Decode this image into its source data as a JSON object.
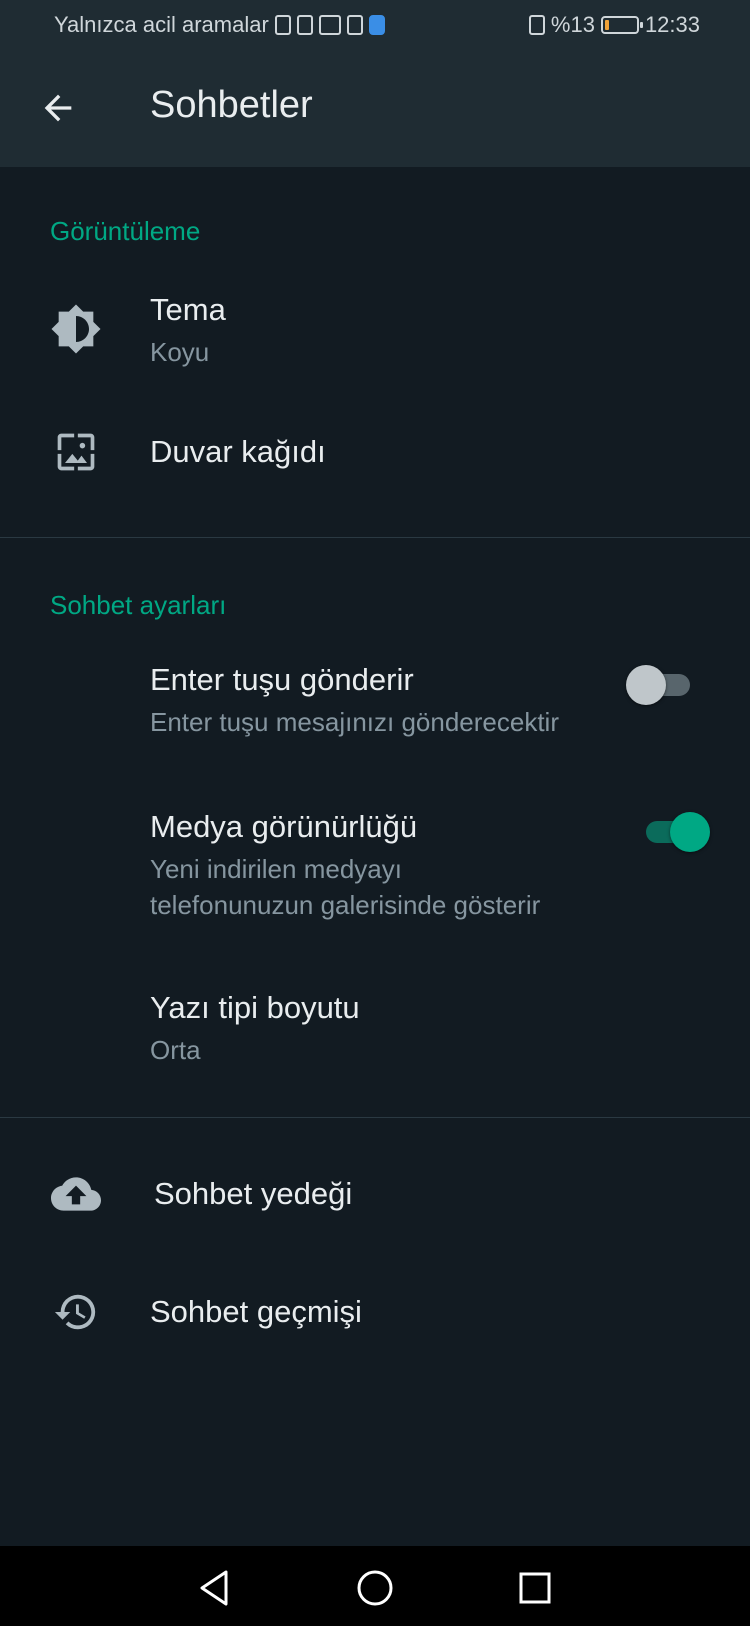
{
  "status_bar": {
    "carrier_text": "Yalnızca acil aramalar",
    "battery_percent_text": "%13",
    "battery_level": 0.13,
    "time": "12:33"
  },
  "app_bar": {
    "title": "Sohbetler",
    "back_icon": "arrow-left-icon"
  },
  "sections": {
    "display": {
      "header": "Görüntüleme",
      "theme": {
        "title": "Tema",
        "subtitle": "Koyu",
        "icon": "brightness-icon"
      },
      "wallpaper": {
        "title": "Duvar kağıdı",
        "icon": "wallpaper-icon"
      }
    },
    "chat_settings": {
      "header": "Sohbet ayarları",
      "enter_is_send": {
        "title": "Enter tuşu gönderir",
        "subtitle": "Enter tuşu mesajınızı gönderecektir",
        "enabled": false
      },
      "media_visibility": {
        "title": "Medya görünürlüğü",
        "subtitle_line1": "Yeni indirilen medyayı",
        "subtitle_line2": "telefonunuzun galerisinde gösterir",
        "enabled": true
      },
      "font_size": {
        "title": "Yazı tipi boyutu",
        "subtitle": "Orta"
      }
    },
    "other": {
      "backup": {
        "title": "Sohbet yedeği",
        "icon": "cloud-upload-icon"
      },
      "history": {
        "title": "Sohbet geçmişi",
        "icon": "history-icon"
      }
    }
  },
  "colors": {
    "accent": "#00a884",
    "background": "#121b22",
    "toolbar": "#1f2c33",
    "primary_text": "#e9edef",
    "secondary_text": "#8696a0",
    "battery_low": "#f0a33a"
  },
  "nav_bar": {
    "back_icon": "nav-back-triangle-icon",
    "home_icon": "nav-home-circle-icon",
    "recents_icon": "nav-recents-square-icon"
  }
}
